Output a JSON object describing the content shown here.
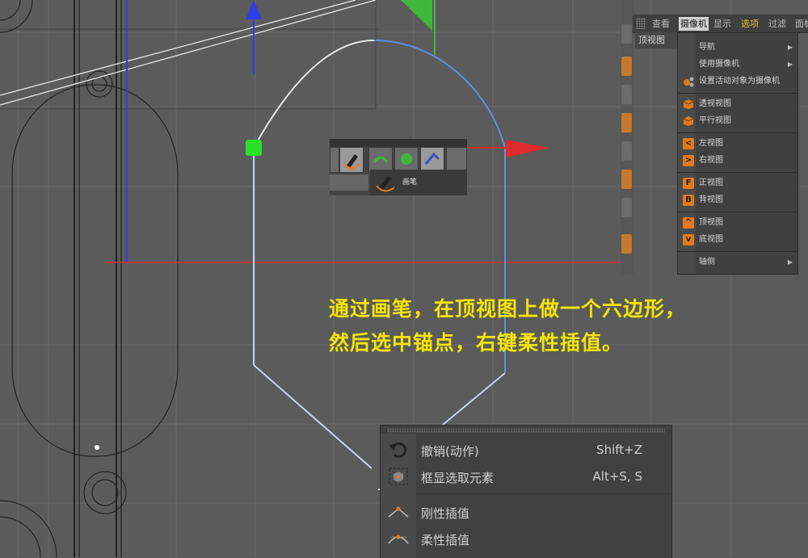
{
  "camera_panel": {
    "tabs": [
      {
        "label": "查看",
        "active": false,
        "highlight": false
      },
      {
        "label": "摄像机",
        "active": true,
        "highlight": false
      },
      {
        "label": "显示",
        "active": false,
        "highlight": false
      },
      {
        "label": "选项",
        "active": false,
        "highlight": true
      },
      {
        "label": "过滤",
        "active": false,
        "highlight": false
      },
      {
        "label": "面板",
        "active": false,
        "highlight": false
      }
    ],
    "view_label": "顶视图",
    "menu": {
      "navigate": "导航",
      "use_camera": "使用摄像机",
      "set_active_camera": "设置活动对象为摄像机",
      "perspective": "透视视图",
      "parallel": "平行视图",
      "left": "左视图",
      "right": "右视图",
      "front": "正视图",
      "back": "背视图",
      "top": "顶视图",
      "bottom": "底视图",
      "axonometric": "轴侧",
      "left_glyph": "<",
      "right_glyph": ">",
      "front_glyph": "F",
      "back_glyph": "B",
      "top_glyph": "^",
      "bottom_glyph": "v"
    }
  },
  "tool_popup": {
    "label": "画笔"
  },
  "instruction": {
    "line1": "通过画笔，在顶视图上做一个六边形，",
    "line2": "然后选中锚点，右键柔性插值。"
  },
  "context_menu": {
    "items": [
      {
        "label": "撤销(动作)",
        "shortcut": "Shift+Z"
      },
      {
        "label": "框显选取元素",
        "shortcut": "Alt+S, S"
      },
      {
        "label": "刚性插值",
        "shortcut": ""
      },
      {
        "label": "柔性插值",
        "shortcut": ""
      }
    ]
  },
  "colors": {
    "viewport_bg": "#5b5b5b",
    "instruction_text": "#f3e500",
    "accent_orange": "#e07a1c",
    "spline_white": "#e6e6e6",
    "spline_blue": "#5b8fe0",
    "axis_red": "#dd2b2b",
    "axis_green": "#3fb83a",
    "axis_blue": "#2d3ee8"
  }
}
